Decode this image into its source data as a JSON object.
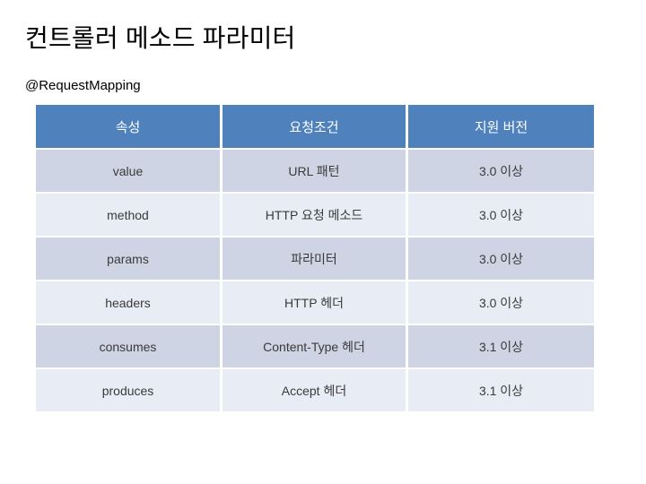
{
  "slide": {
    "title": "컨트롤러 메소드 파라미터",
    "subtitle": "@RequestMapping",
    "background_color": "#FFFFFF",
    "title_color": "#000000"
  },
  "table": {
    "header_bg": "#4F81BD",
    "header_text_color": "#FFFFFF",
    "row_band_dark": "#CED4E3",
    "row_band_light": "#E8ECF4",
    "body_text_color": "#3A3A3A",
    "columns": [
      "속성",
      "요청조건",
      "지원 버전"
    ],
    "rows": [
      {
        "attribute": "value",
        "condition": "URL 패턴",
        "version": "3.0 이상"
      },
      {
        "attribute": "method",
        "condition": "HTTP 요청 메소드",
        "version": "3.0 이상"
      },
      {
        "attribute": "params",
        "condition": "파라미터",
        "version": "3.0 이상"
      },
      {
        "attribute": "headers",
        "condition": "HTTP 헤더",
        "version": "3.0 이상"
      },
      {
        "attribute": "consumes",
        "condition": "Content-Type 헤더",
        "version": "3.1 이상"
      },
      {
        "attribute": "produces",
        "condition": "Accept 헤더",
        "version": "3.1 이상"
      }
    ]
  }
}
